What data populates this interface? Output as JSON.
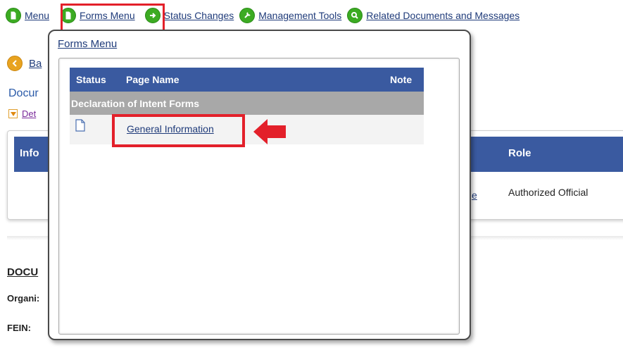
{
  "nav": {
    "items": [
      {
        "label": "Menu",
        "icon": "document-icon"
      },
      {
        "label": "Forms Menu",
        "icon": "document-icon"
      },
      {
        "label": "Status Changes",
        "icon": "arrow-right-icon"
      },
      {
        "label": "Management Tools",
        "icon": "wrench-icon"
      },
      {
        "label": "Related Documents and Messages",
        "icon": "search-icon"
      }
    ]
  },
  "background": {
    "back_label": "Ba",
    "doc_title": "Docur",
    "details_label": "Det",
    "table_header_left": "Info",
    "table_header_right": "Role",
    "row_link_fragment": "e",
    "row_role": "Authorized Official",
    "section_heading": "DOCU",
    "org_label": "Organi:",
    "fein_label": "FEIN:"
  },
  "forms_popup": {
    "title": "Forms Menu",
    "columns": {
      "status": "Status",
      "page_name": "Page Name",
      "note": "Note"
    },
    "section": "Declaration of Intent Forms",
    "rows": [
      {
        "page_name": "General Information",
        "status_icon": "document-icon"
      }
    ]
  },
  "colors": {
    "header_blue": "#3a5aa0",
    "section_gray": "#a8a8a8",
    "highlight_red": "#e3202a",
    "nav_green": "#3cab22",
    "link_blue": "#1f3b7a"
  }
}
